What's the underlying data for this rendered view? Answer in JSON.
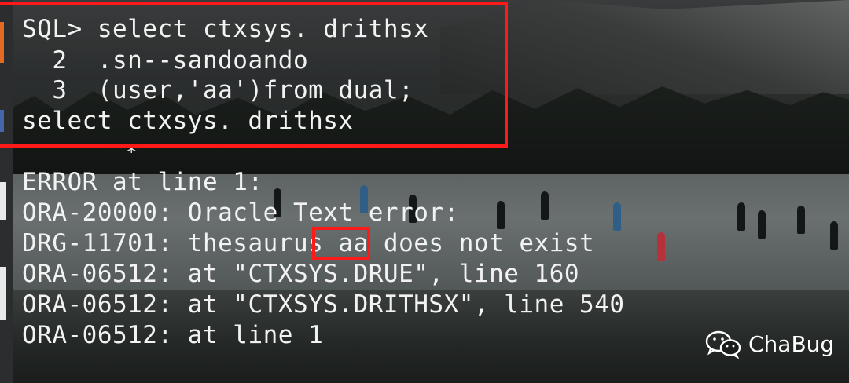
{
  "terminal": {
    "lines": [
      "SQL> select ctxsys. drithsx",
      "  2  .sn--sandoando",
      "  3  (user,'aa')from dual;",
      "select ctxsys. drithsx",
      "ERROR at line 1:",
      "ORA-20000: Oracle Text error:",
      "DRG-11701: thesaurus aa does not exist",
      "ORA-06512: at \"CTXSYS.DRUE\", line 160",
      "ORA-06512: at \"CTXSYS.DRITHSX\", line 540",
      "ORA-06512: at line 1"
    ],
    "error_caret": "*"
  },
  "watermark": {
    "label": "ChaBug",
    "icon": "wechat-icon"
  },
  "colors": {
    "highlight": "#ff1a1a",
    "text": "#f2f2f2"
  }
}
